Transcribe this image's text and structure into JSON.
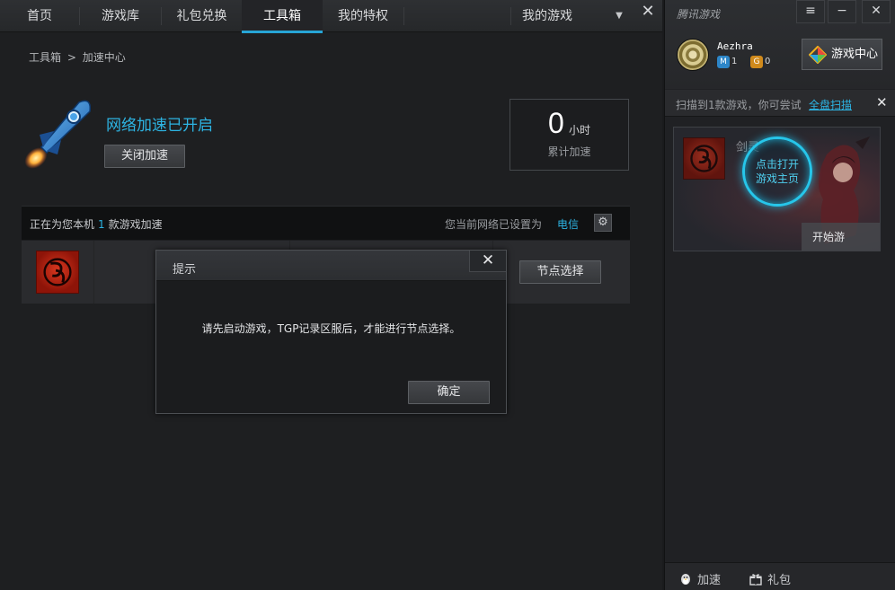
{
  "nav": {
    "tabs": [
      {
        "label": "首页"
      },
      {
        "label": "游戏库"
      },
      {
        "label": "礼包兑换"
      },
      {
        "label": "工具箱"
      },
      {
        "label": "我的特权"
      },
      {
        "label": "我的游戏"
      }
    ],
    "active_tab": "工具箱",
    "dropdown_icon": "chevron-down-icon",
    "close_icon": "close-icon"
  },
  "breadcrumb": {
    "root": "工具箱",
    "separator": ">",
    "current": "加速中心"
  },
  "accel": {
    "status": "网络加速已开启",
    "toggle_button": "关闭加速",
    "hours_value": "0",
    "hours_unit": "小时",
    "hours_label": "累计加速"
  },
  "game_bar": {
    "prefix": "正在为您本机",
    "count": "1",
    "suffix": "款游戏加速",
    "network_label": "您当前网络已设置为",
    "isp": "电信"
  },
  "game_row": {
    "node_button": "节点选择"
  },
  "dialog": {
    "title": "提示",
    "message": "请先启动游戏，TGP记录区服后，才能进行节点选择。",
    "ok_button": "确定"
  },
  "sidebar": {
    "brand": "腾讯游戏",
    "username": "Aezhra",
    "badge_level": "1",
    "badge_coins": "0",
    "game_center": "游戏中心",
    "scan_text": "扫描到1款游戏，你可尝试",
    "scan_link": "全盘扫描",
    "promo": {
      "title": "剑灵",
      "open_line1": "点击打开",
      "open_line2": "游戏主页",
      "start": "开始游戏"
    },
    "footer": [
      {
        "label": "加速"
      },
      {
        "label": "礼包"
      }
    ]
  },
  "colors": {
    "accent": "#2db4e3",
    "active_tab_underline": "#27a5d6",
    "background": "#1e1f21"
  }
}
